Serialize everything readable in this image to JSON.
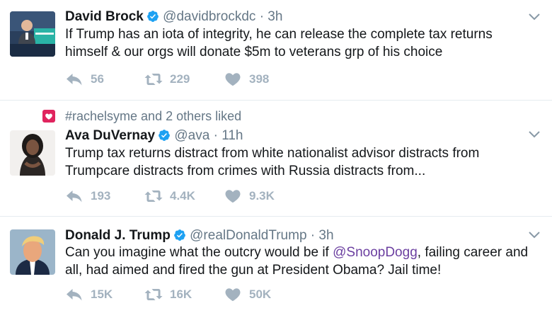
{
  "tweets": [
    {
      "name": "David Brock",
      "handle": "@davidbrockdc",
      "separator": "·",
      "time": "3h",
      "text": "If Trump has an iota of integrity, he can release the complete tax returns himself & our orgs will donate $5m to veterans grp of his choice",
      "replies": "56",
      "retweets": "229",
      "likes": "398"
    },
    {
      "context": "#rachelsyme and 2 others liked",
      "name": "Ava DuVernay",
      "handle": "@ava",
      "separator": "·",
      "time": "11h",
      "text": "Trump tax returns distract from white nationalist advisor distracts from Trumpcare distracts from crimes with Russia distracts from...",
      "replies": "193",
      "retweets": "4.4K",
      "likes": "9.3K"
    },
    {
      "name": "Donald J. Trump",
      "handle": "@realDonaldTrump",
      "separator": "·",
      "time": "3h",
      "text_before": "Can you imagine what the outcry would be if ",
      "mention": "@SnoopDogg",
      "text_after": ", failing career and all, had aimed and fired the gun at President Obama? Jail time!",
      "replies": "15K",
      "retweets": "16K",
      "likes": "50K"
    }
  ],
  "colors": {
    "verified": "#1da1f2",
    "action_gray": "#a3b2bf",
    "like_badge": "#e0245e",
    "mention": "#6b3fa0"
  }
}
